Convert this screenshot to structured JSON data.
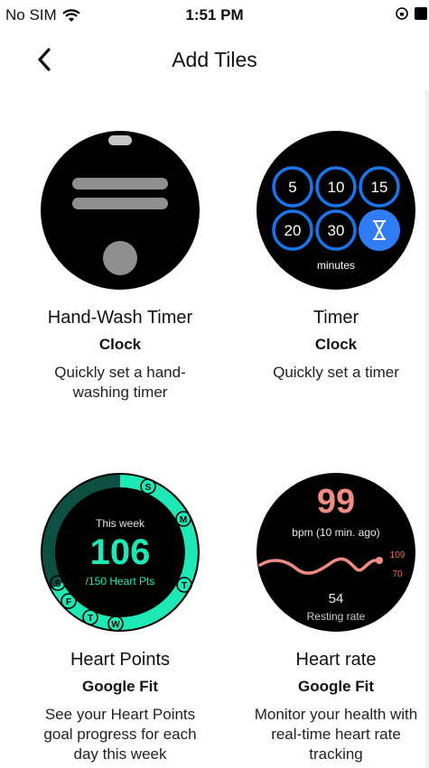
{
  "status": {
    "carrier": "No SIM",
    "time": "1:51 PM"
  },
  "nav": {
    "title": "Add Tiles"
  },
  "tiles": [
    {
      "name": "Hand-Wash Timer",
      "app": "Clock",
      "description": "Quickly set a hand-washing timer"
    },
    {
      "name": "Timer",
      "app": "Clock",
      "description": "Quickly set a timer",
      "preview": {
        "options": [
          "5",
          "10",
          "15",
          "20",
          "30"
        ],
        "unit": "minutes"
      }
    },
    {
      "name": "Heart Points",
      "app": "Google Fit",
      "description": "See your Heart Points goal progress for each day this week",
      "preview": {
        "period": "This week",
        "value": "106",
        "goal": "/150 Heart Pts",
        "days": [
          "S",
          "M",
          "T",
          "W",
          "T",
          "F",
          "S"
        ]
      }
    },
    {
      "name": "Heart rate",
      "app": "Google Fit",
      "description": "Monitor your health with real-time heart rate tracking",
      "preview": {
        "bpm": "99",
        "bpm_label": "bpm (10 min. ago)",
        "max": "109",
        "min": "70",
        "resting": "54",
        "resting_label": "Resting rate"
      }
    }
  ],
  "colors": {
    "accent": "#1a73e8",
    "teal": "#1de9b6",
    "heart": "#f28b82"
  }
}
